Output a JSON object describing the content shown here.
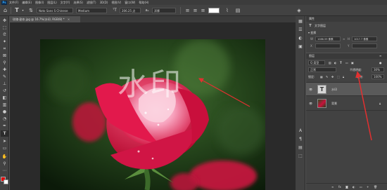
{
  "menubar": {
    "logo": "Ps",
    "items": [
      "文件(F)",
      "编辑(E)",
      "图像(I)",
      "图层(L)",
      "文字(Y)",
      "选择(S)",
      "滤镜(T)",
      "3D(D)",
      "视图(V)",
      "窗口(W)",
      "帮助(H)"
    ]
  },
  "options": {
    "font_family": "Noto Sans S Chinese",
    "font_style": "Medium",
    "font_size": "206.25 点",
    "antialias": "浑厚",
    "antialias_prefix": "aₐ"
  },
  "document": {
    "tab_title": "玫瑰-副本.jpg @ 16.7%(水印, RGB/8) *"
  },
  "canvas": {
    "watermark_text": "水印"
  },
  "properties_panel": {
    "tab_label": "属性",
    "type_label": "文字图层",
    "transform_label": "变换",
    "w_label": "W",
    "w_value": "1086.59 像素",
    "h_label": "H",
    "h_value": "1017.7 像素",
    "x_label": "X",
    "x_value": "",
    "y_label": "Y",
    "y_value": ""
  },
  "layers_panel": {
    "tab_label": "图层",
    "filter_label": "Q 类型",
    "blend_mode": "正常",
    "opacity_label": "不透明度:",
    "opacity_value": "30%",
    "fill_label": "填充:",
    "fill_value": "100%",
    "lock_label": "锁定:",
    "layers": [
      {
        "name": "水印",
        "type_icon": "T"
      },
      {
        "name": "背景"
      }
    ]
  },
  "colors": {
    "accent_arrow": "#e23030",
    "foreground": "#e00000",
    "background_swatch": "#ffffff"
  }
}
